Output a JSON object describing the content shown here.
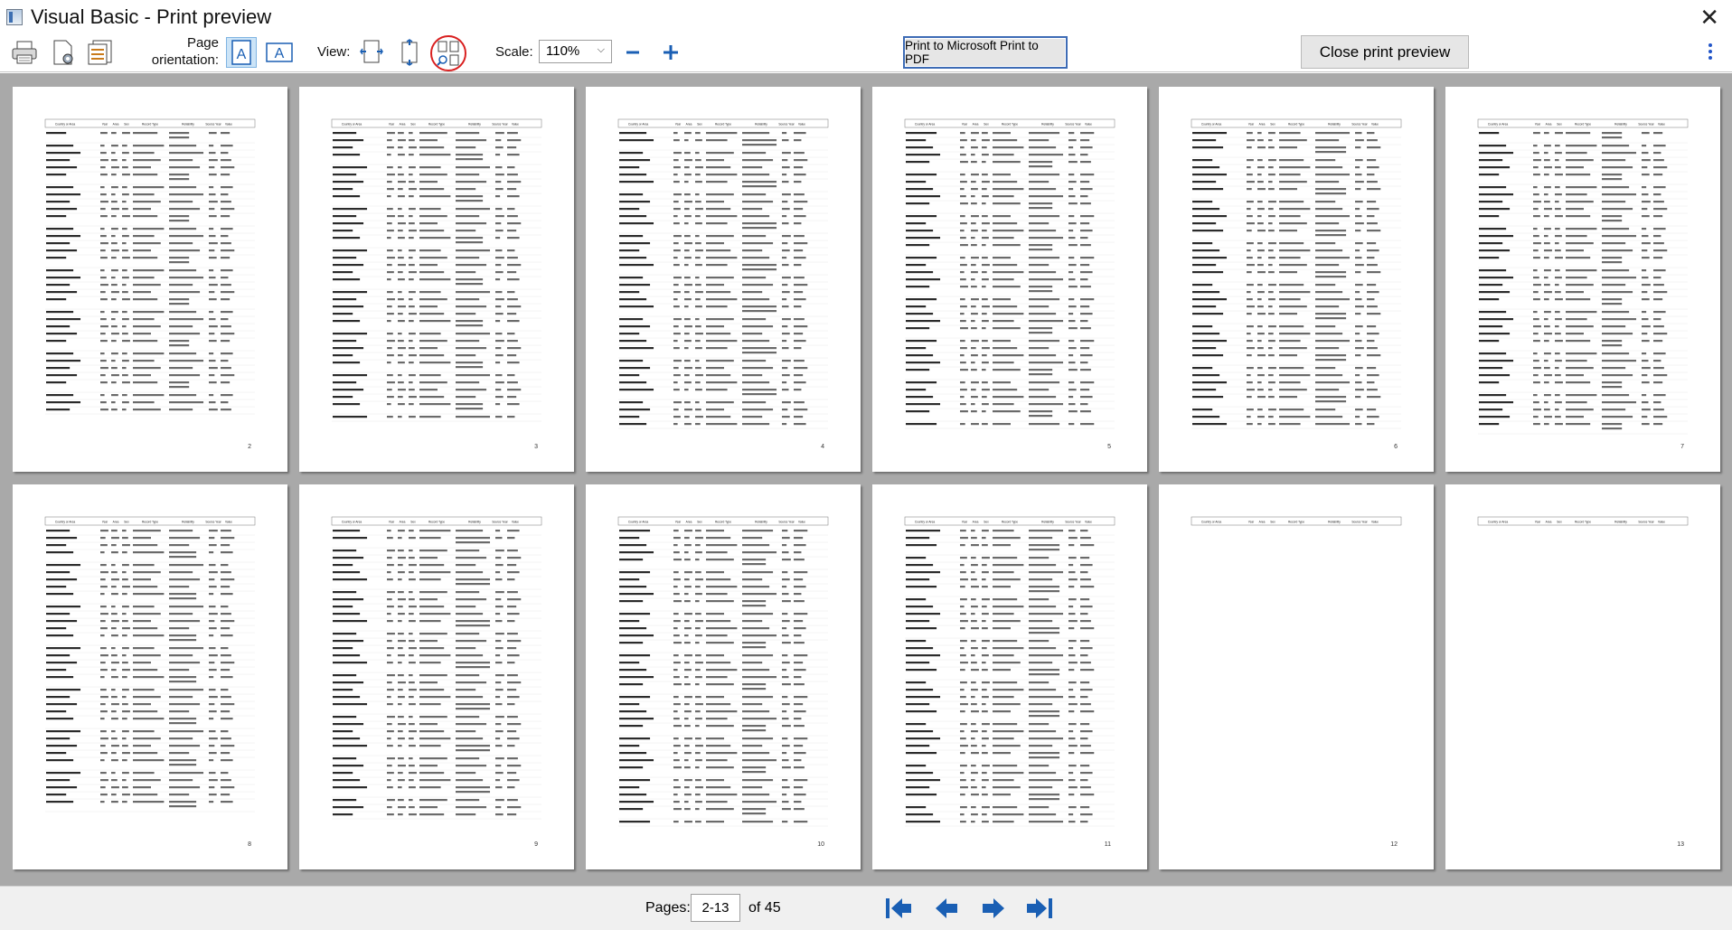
{
  "window": {
    "title": "Visual Basic - Print preview"
  },
  "toolbar": {
    "print_icon": "printer-icon",
    "page_setup_icon": "page-setup-icon",
    "print_settings_icon": "print-settings-icon",
    "page_orientation_label": "Page orientation:",
    "view_label": "View:",
    "scale_label": "Scale:",
    "scale_value": "110%",
    "pdf_button": "Print to Microsoft Print to PDF",
    "close_preview_button": "Close print preview"
  },
  "preview": {
    "header_columns": [
      "Country or Area",
      "Year",
      "Area",
      "Sex",
      "Record Type",
      "Reliability",
      "Source Year",
      "Value"
    ],
    "pages": [
      {
        "number": "2"
      },
      {
        "number": "3"
      },
      {
        "number": "4"
      },
      {
        "number": "5"
      },
      {
        "number": "6"
      },
      {
        "number": "7"
      },
      {
        "number": "8"
      },
      {
        "number": "9"
      },
      {
        "number": "10"
      },
      {
        "number": "11"
      },
      {
        "number": "12"
      },
      {
        "number": "13"
      }
    ]
  },
  "statusbar": {
    "pages_label": "Pages:",
    "pages_value": "2-13",
    "of_label": "of 45"
  },
  "colors": {
    "accent": "#1a5fb4",
    "highlight_ring": "#d92020",
    "viewport_bg": "#a9a9a9"
  }
}
